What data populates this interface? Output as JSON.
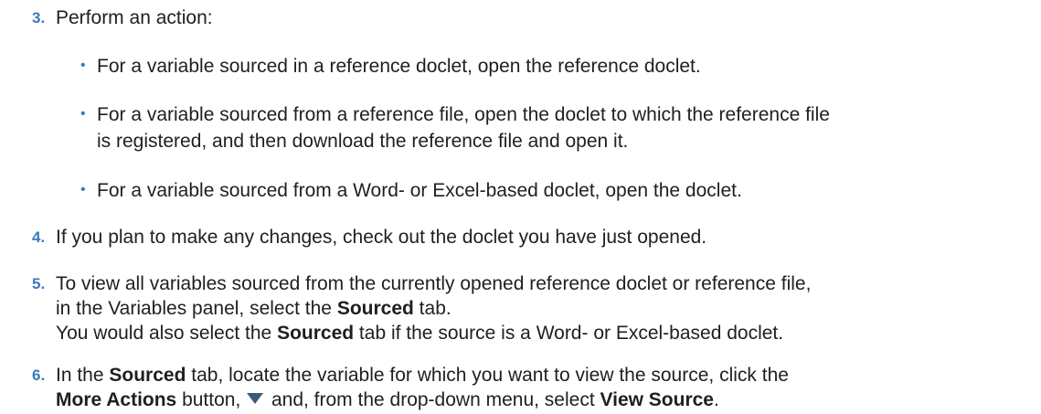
{
  "steps": [
    {
      "number": "3.",
      "text": "Perform an action:",
      "bullets": [
        "For a variable sourced in a reference doclet, open the reference doclet.",
        "For a variable sourced from a reference file, open the doclet to which the reference file",
        "is registered, and then download the reference file and open it.",
        "For a variable sourced from a Word- or Excel-based doclet, open the doclet."
      ]
    },
    {
      "number": "4.",
      "text": "If you plan to make any changes, check out the doclet you have just opened."
    },
    {
      "number": "5.",
      "line1": "To view all variables sourced from the currently opened reference doclet or reference file,",
      "line2_a": "in the Variables panel, select the ",
      "line2_b": "Sourced",
      "line2_c": " tab.",
      "line3_a": "You would also select the ",
      "line3_b": "Sourced",
      "line3_c": " tab if the source is a Word- or Excel-based doclet."
    },
    {
      "number": "6.",
      "line1_a": "In the ",
      "line1_b": "Sourced",
      "line1_c": " tab, locate the variable for which you want to view the source, click the",
      "line2_a": "More Actions",
      "line2_b": " button, ",
      "line2_c": " and, from the drop-down menu, select ",
      "line2_d": "View Source",
      "line2_e": "."
    }
  ],
  "bullet_glyph": "•",
  "icons": {
    "more_actions": "dropdown-triangle-icon"
  },
  "colors": {
    "step_number": "#3d7ab8",
    "text": "#1f1f1f",
    "icon": "#3a5a7a"
  }
}
